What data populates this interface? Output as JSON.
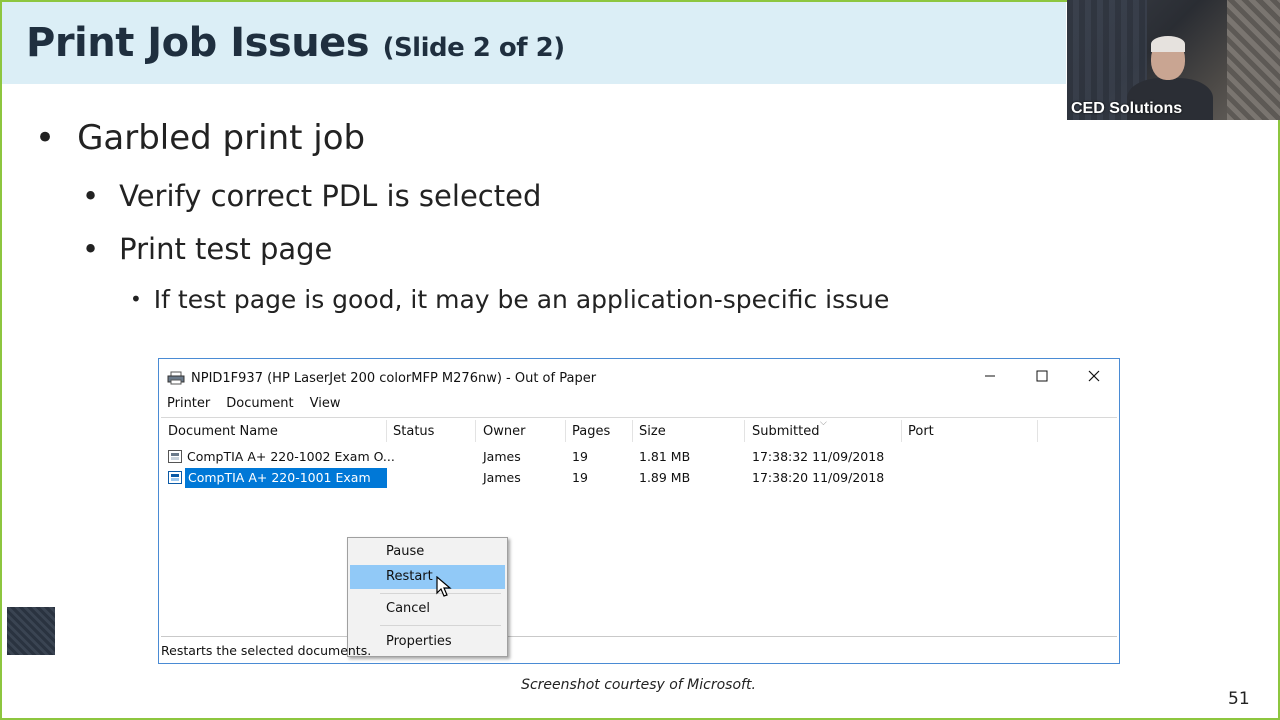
{
  "slide": {
    "title": "Print Job Issues",
    "title_sub": "(Slide 2 of 2)",
    "page_number": "51",
    "caption": "Screenshot courtesy of Microsoft."
  },
  "webcam": {
    "label": "CED Solutions"
  },
  "bullets": [
    {
      "level": 1,
      "text": "Garbled print job"
    },
    {
      "level": 2,
      "text": "Verify correct PDL is selected"
    },
    {
      "level": 2,
      "text": "Print test page"
    },
    {
      "level": 3,
      "text": "If test page is good, it may be an application-specific issue"
    }
  ],
  "window": {
    "title": "NPID1F937 (HP LaserJet 200 colorMFP M276nw) - Out of Paper",
    "menu": [
      "Printer",
      "Document",
      "View"
    ],
    "columns": [
      "Document Name",
      "Status",
      "Owner",
      "Pages",
      "Size",
      "Submitted",
      "Port"
    ],
    "rows": [
      {
        "name": "CompTIA A+ 220-1002 Exam O...",
        "status": "",
        "owner": "James",
        "pages": "19",
        "size": "1.81 MB",
        "submitted": "17:38:32  11/09/2018",
        "port": ""
      },
      {
        "name": "CompTIA A+ 220-1001 Exam O...",
        "status": "",
        "owner": "James",
        "pages": "19",
        "size": "1.89 MB",
        "submitted": "17:38:20  11/09/2018",
        "port": ""
      }
    ],
    "context_menu": [
      "Pause",
      "Restart",
      "Cancel",
      "Properties"
    ],
    "highlighted_item": "Restart",
    "status_bar": "Restarts the selected documents."
  },
  "colors": {
    "title_bg": "#dbeef6",
    "frame": "#8dc63f",
    "selection": "#0078d7",
    "menu_highlight": "#91c9f7",
    "window_border": "#4a8bd4"
  }
}
